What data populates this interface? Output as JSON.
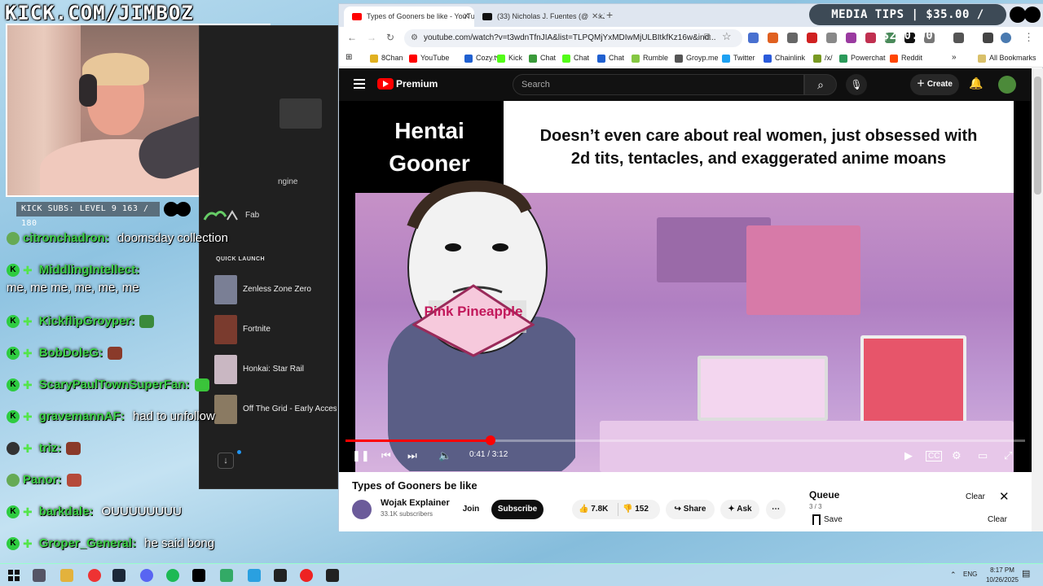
{
  "overlay": {
    "stream_url": "KICK.COM/JIMBOZ",
    "subs_text": "KICK SUBS: LEVEL 9 163 / 180",
    "media_tips": "MEDIA TIPS | $35.00 / $200.00"
  },
  "chat": [
    {
      "user": "citronchadron:",
      "text": "doomsday collection",
      "badge": "avatar"
    },
    {
      "user": "MiddlingIntellect:",
      "text": "me, me me, me, me, me",
      "badge": "k-sub",
      "wrap": true
    },
    {
      "user": "KickflipGroyper:",
      "text": "",
      "badge": "k-sub"
    },
    {
      "user": "BobDoleG:",
      "text": "",
      "badge": "k-sub"
    },
    {
      "user": "ScaryPaulTownSuperFan:",
      "text": "",
      "badge": "k-sub"
    },
    {
      "user": "gravemannAF:",
      "text": "had to unfollow",
      "badge": "k-sub"
    },
    {
      "user": "triz:",
      "text": "",
      "badge": "avatar-sub"
    },
    {
      "user": "Panor:",
      "text": "",
      "badge": "avatar"
    },
    {
      "user": "barkdale:",
      "text": "OUUUUUUUU",
      "badge": "k-sub"
    },
    {
      "user": "Groper_General:",
      "text": "he said bong",
      "badge": "k-sub"
    }
  ],
  "start_menu": {
    "partial_label": "ngine",
    "fab_label": "Fab",
    "quick_launch_label": "QUICK LAUNCH",
    "games": [
      {
        "name": "Zenless Zone Zero",
        "color": "#7a7f95"
      },
      {
        "name": "Fortnite",
        "color": "#7a3b2e"
      },
      {
        "name": "Honkai: Star Rail",
        "color": "#c9b7c2"
      },
      {
        "name": "Off The Grid - Early Access",
        "color": "#8a7a62"
      }
    ],
    "download_icon": "download-icon"
  },
  "browser": {
    "tabs": [
      {
        "title": "Types of Gooners be like - YouTube",
        "active": true
      },
      {
        "title": "(33) Nicholas J. Fuentes (@NickJFuentes)",
        "active": false
      }
    ],
    "url": "youtube.com/watch?v=t3wdnTfnJIA&list=TLPQMjYxMDIwMjULBItkfKz16w&ind...",
    "bookmarks": [
      {
        "label": "8Chan",
        "color": "#e0b020"
      },
      {
        "label": "YouTube",
        "color": "#f00"
      },
      {
        "label": "Cozy.tv",
        "color": "#2060d0"
      },
      {
        "label": "Kick",
        "color": "#53fc18"
      },
      {
        "label": "Chat",
        "color": "#3a9a3a"
      },
      {
        "label": "Chat",
        "color": "#53fc18"
      },
      {
        "label": "Chat",
        "color": "#2060d0"
      },
      {
        "label": "Rumble",
        "color": "#85c742"
      },
      {
        "label": "Groyp.me",
        "color": "#555"
      },
      {
        "label": "Twitter",
        "color": "#1da1f2"
      },
      {
        "label": "Chainlink",
        "color": "#2a5ada"
      },
      {
        "label": "/x/",
        "color": "#789922"
      },
      {
        "label": "Powerchat",
        "color": "#2b9a5a"
      },
      {
        "label": "Reddit",
        "color": "#ff4500"
      }
    ],
    "all_bookmarks": "All Bookmarks"
  },
  "youtube": {
    "premium_label": "Premium",
    "search_placeholder": "Search",
    "create_label": "Create",
    "video": {
      "left_caption": "Hentai Gooner",
      "right_caption": "Doesn’t even care about real women, just obsessed with 2d tits, tentacles, and exaggerated anime moans",
      "overlay_logo": "Pink Pineapple",
      "time": "0:41 / 3:12",
      "progress": 0.2135
    },
    "title": "Types of Gooners be like",
    "channel": "Wojak Explainer",
    "subscribers": "33.1K subscribers",
    "join_label": "Join",
    "subscribe_label": "Subscribe",
    "likes": "7.8K",
    "dislikes": "152",
    "share_label": "Share",
    "ask_label": "Ask",
    "more_label": "⋯",
    "queue": {
      "title": "Queue",
      "count": "3 / 3",
      "clear_label": "Clear",
      "save_label": "Save",
      "clear2_label": "Clear"
    }
  },
  "taskbar": {
    "lang": "ENG",
    "time": "8:17 PM",
    "date": "10/26/2025"
  }
}
